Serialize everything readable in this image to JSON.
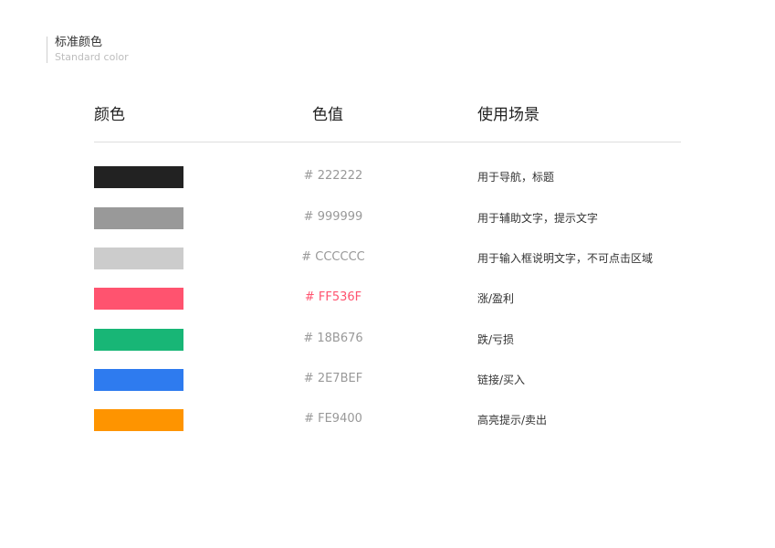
{
  "header": {
    "title": "标准颜色",
    "subtitle": "Standard color"
  },
  "columns": [
    "颜色",
    "色值",
    "使用场景"
  ],
  "colors": [
    {
      "hex_label": "# 222222",
      "swatch": "#222222",
      "hex_color": "#999999",
      "usage": "用于导航，标题"
    },
    {
      "hex_label": "# 999999",
      "swatch": "#999999",
      "hex_color": "#999999",
      "usage": "用于辅助文字，提示文字"
    },
    {
      "hex_label": "# CCCCCC",
      "swatch": "#CCCCCC",
      "hex_color": "#999999",
      "usage": "用于输入框说明文字，不可点击区域"
    },
    {
      "hex_label": "# FF536F",
      "swatch": "#FF536F",
      "hex_color": "#FF536F",
      "usage": "涨/盈利"
    },
    {
      "hex_label": "# 18B676",
      "swatch": "#18B676",
      "hex_color": "#999999",
      "usage": "跌/亏损"
    },
    {
      "hex_label": "# 2E7BEF",
      "swatch": "#2E7BEF",
      "hex_color": "#999999",
      "usage": "链接/买入"
    },
    {
      "hex_label": "# FE9400",
      "swatch": "#FE9400",
      "hex_color": "#999999",
      "usage": "高亮提示/卖出"
    }
  ]
}
